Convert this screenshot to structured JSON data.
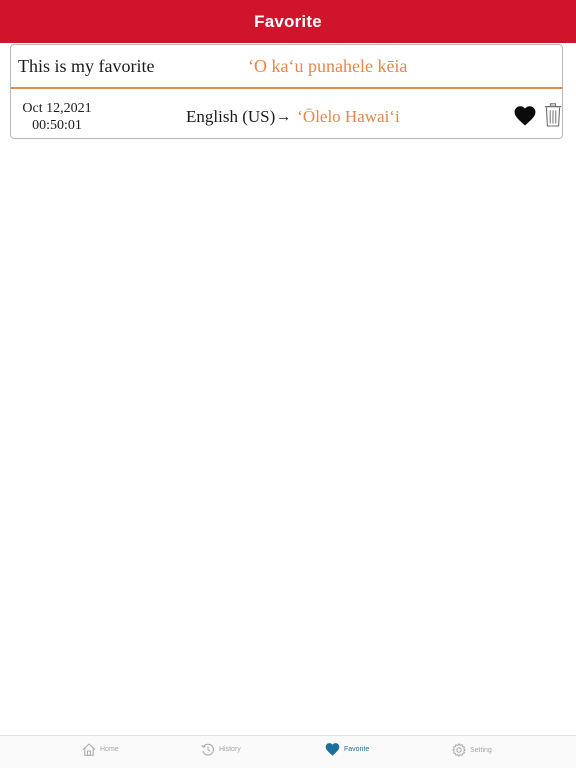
{
  "header": {
    "title": "Favorite"
  },
  "favorite": {
    "source_text": "This is my favorite",
    "translated_text": "ʻO kaʻu punahele kēia",
    "date": "Oct 12,2021",
    "time": "00:50:01",
    "from_language": "English (US)",
    "arrow": "→",
    "to_language": "ʻŌlelo Hawaiʻi",
    "heart_icon": "heart-icon",
    "trash_icon": "trash-icon"
  },
  "tabs": [
    {
      "label": "Home",
      "icon": "home-icon"
    },
    {
      "label": "History",
      "icon": "history-icon"
    },
    {
      "label": "Favorite",
      "icon": "heart-icon",
      "active": true
    },
    {
      "label": "Setting",
      "icon": "gear-icon"
    }
  ],
  "colors": {
    "header_bg": "#d0142b",
    "accent_orange": "#e7854a",
    "tab_active": "#1f6e9c",
    "tab_inactive": "#a6a6a6"
  }
}
